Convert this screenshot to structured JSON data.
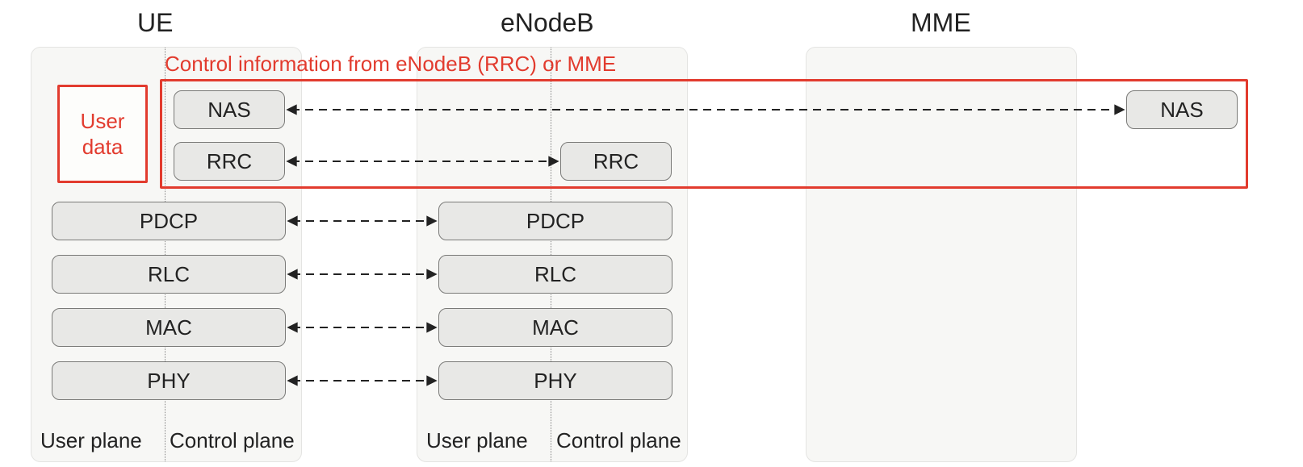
{
  "titles": {
    "ue": "UE",
    "enb": "eNodeB",
    "mme": "MME"
  },
  "red": {
    "user_data_line1": "User",
    "user_data_line2": "data",
    "caption": "Control information from eNodeB (RRC) or MME"
  },
  "planes": {
    "user": "User plane",
    "control": "Control plane"
  },
  "ue": {
    "nas": "NAS",
    "rrc": "RRC",
    "pdcp": "PDCP",
    "rlc": "RLC",
    "mac": "MAC",
    "phy": "PHY"
  },
  "enb": {
    "rrc": "RRC",
    "pdcp": "PDCP",
    "rlc": "RLC",
    "mac": "MAC",
    "phy": "PHY"
  },
  "mme": {
    "nas": "NAS"
  }
}
